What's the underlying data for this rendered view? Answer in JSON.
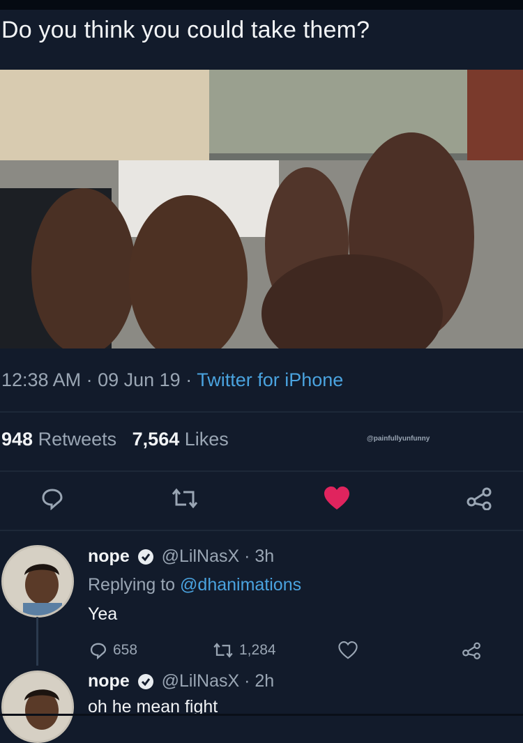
{
  "tweet": {
    "text": "Do you think you could take them?",
    "time": "12:38 AM",
    "date": "09 Jun 19",
    "source": "Twitter for iPhone",
    "retweets_count": "948",
    "retweets_label": "Retweets",
    "likes_count": "7,564",
    "likes_label": "Likes",
    "watermark": "@painfullyunfunny"
  },
  "colors": {
    "background": "#121b2b",
    "link": "#4aa3df",
    "like": "#e0245e",
    "muted": "#9aa6b4"
  },
  "icons": [
    "reply-icon",
    "retweet-icon",
    "like-icon-filled",
    "share-icon",
    "verified-icon"
  ],
  "replies": [
    {
      "name": "nope",
      "handle": "@LilNasX",
      "age": "3h",
      "replying_prefix": "Replying to",
      "replying_to": "@dhanimations",
      "text": "Yea",
      "reply_count": "658",
      "retweet_count": "1,284"
    },
    {
      "name": "nope",
      "handle": "@LilNasX",
      "age": "2h",
      "text": "oh he mean fight"
    }
  ]
}
